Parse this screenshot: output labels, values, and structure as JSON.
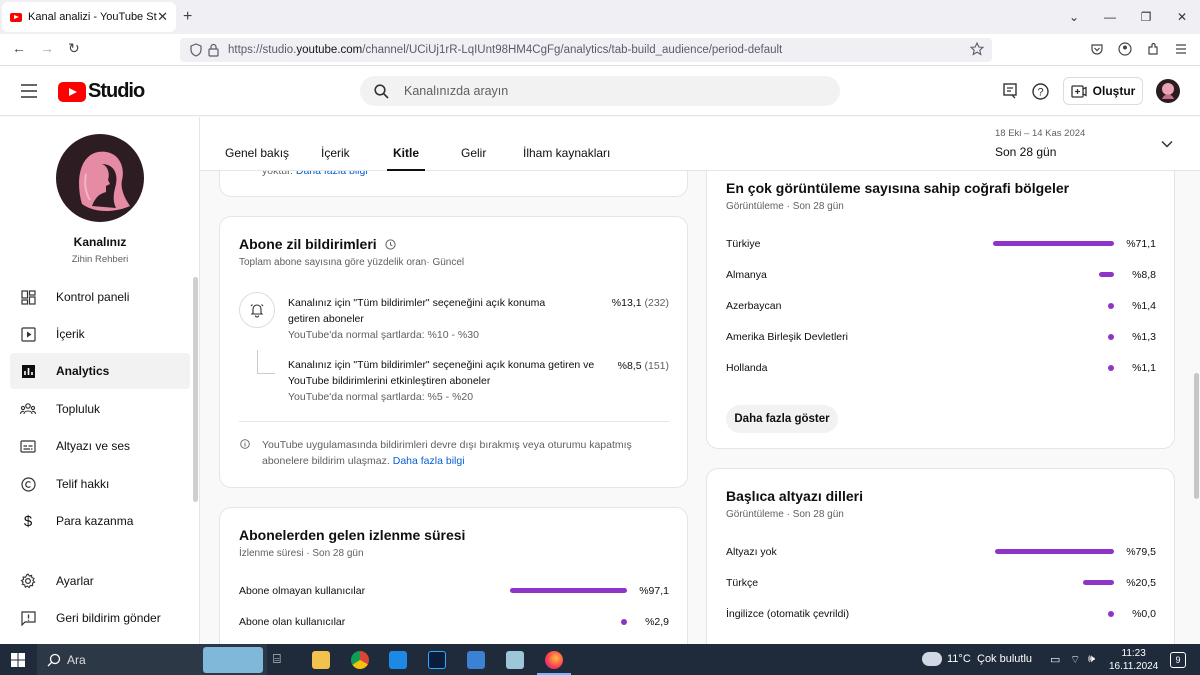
{
  "browser": {
    "tab_title": "Kanal analizi - YouTube Studio",
    "url_prefix": "https://studio.",
    "url_domain": "youtube.com",
    "url_path": "/channel/UCiUj1rR-LqIUnt98HM4CgFg/analytics/tab-build_audience/period-default"
  },
  "header": {
    "logo_text": "Studio",
    "search_placeholder": "Kanalınızda arayın",
    "create_label": "Oluştur"
  },
  "sidebar": {
    "channel_name": "Kanalınız",
    "channel_sub": "Zihin Rehberi",
    "items": [
      {
        "label": "Kontrol paneli",
        "icon": "dashboard-icon"
      },
      {
        "label": "İçerik",
        "icon": "content-icon"
      },
      {
        "label": "Analytics",
        "icon": "analytics-icon"
      },
      {
        "label": "Topluluk",
        "icon": "community-icon"
      },
      {
        "label": "Altyazı ve ses",
        "icon": "subtitles-icon"
      },
      {
        "label": "Telif hakkı",
        "icon": "copyright-icon"
      },
      {
        "label": "Para kazanma",
        "icon": "dollar-icon"
      },
      {
        "label": "Ayarlar",
        "icon": "gear-icon"
      },
      {
        "label": "Geri bildirim gönder",
        "icon": "feedback-icon"
      }
    ]
  },
  "tabs": [
    "Genel bakış",
    "İçerik",
    "Kitle",
    "Gelir",
    "İlham kaynakları"
  ],
  "period": {
    "dates": "18 Eki – 14 Kas 2024",
    "label": "Son 28 gün"
  },
  "top_stub": {
    "text": "yoktur.",
    "link": "Daha fazla bilgi"
  },
  "bell_card": {
    "title": "Abone zil bildirimleri",
    "subtitle": "Toplam abone sayısına göre yüzdelik oran· Güncel",
    "row1": {
      "text": "Kanalınız için \"Tüm bildirimler\" seçeneğini açık konuma getiren aboneler",
      "value": "%13,1",
      "count": "(232)",
      "normal": "YouTube'da normal şartlarda: %10 - %30"
    },
    "row2": {
      "text": "Kanalınız için \"Tüm bildirimler\" seçeneğini açık konuma getiren ve YouTube bildirimlerini etkinleştiren aboneler",
      "value": "%8,5",
      "count": "(151)",
      "normal": "YouTube'da normal şartlarda: %5 - %20"
    },
    "info": "YouTube uygulamasında bildirimleri devre dışı bırakmış veya oturumu kapatmış abonelere bildirim ulaşmaz.",
    "info_link": "Daha fazla bilgi"
  },
  "watch_card": {
    "title": "Abonelerden gelen izlenme süresi",
    "subtitle": "İzlenme süresi · Son 28 gün",
    "rows": [
      {
        "label": "Abone olmayan kullanıcılar",
        "value": "%97,1",
        "fraction": 0.971
      },
      {
        "label": "Abone olan kullanıcılar",
        "value": "%2,9",
        "fraction": 0.029
      }
    ]
  },
  "geo_card": {
    "title": "En çok görüntüleme sayısına sahip coğrafi bölgeler",
    "subtitle": "Görüntüleme · Son 28 gün",
    "rows": [
      {
        "label": "Türkiye",
        "value": "%71,1",
        "fraction": 0.711
      },
      {
        "label": "Almanya",
        "value": "%8,8",
        "fraction": 0.088
      },
      {
        "label": "Azerbaycan",
        "value": "%1,4",
        "fraction": 0.014
      },
      {
        "label": "Amerika Birleşik Devletleri",
        "value": "%1,3",
        "fraction": 0.013
      },
      {
        "label": "Hollanda",
        "value": "%1,1",
        "fraction": 0.011
      }
    ],
    "more": "Daha fazla göster"
  },
  "lang_card": {
    "title": "Başlıca altyazı dilleri",
    "subtitle": "Görüntüleme · Son 28 gün",
    "rows": [
      {
        "label": "Altyazı yok",
        "value": "%79,5",
        "fraction": 0.795
      },
      {
        "label": "Türkçe",
        "value": "%20,5",
        "fraction": 0.205
      },
      {
        "label": "İngilizce (otomatik çevrildi)",
        "value": "%0,0",
        "fraction": 0.0
      }
    ]
  },
  "taskbar": {
    "search": "Ara",
    "weather": "11°C",
    "weather_desc": "Çok bulutlu",
    "time": "11:23",
    "date": "16.11.2024",
    "notif": "9"
  },
  "colors": {
    "bar": "#8e35c7",
    "youtube_red": "#ff0000"
  }
}
